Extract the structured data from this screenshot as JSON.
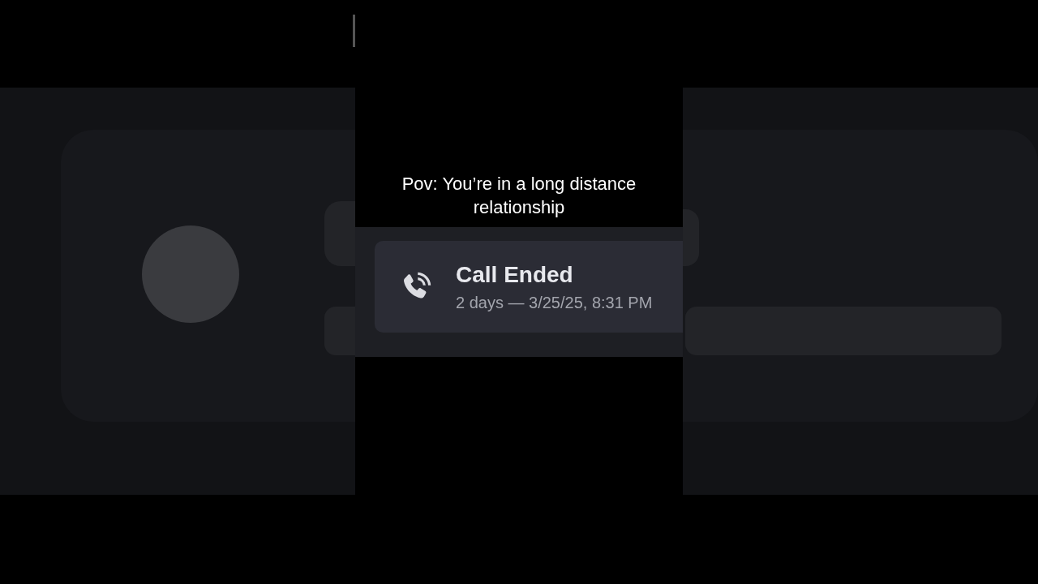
{
  "caption": "Pov: You’re in a long distance relationship",
  "call": {
    "title": "Call Ended",
    "detail": "2 days — 3/25/25, 8:31 PM"
  }
}
